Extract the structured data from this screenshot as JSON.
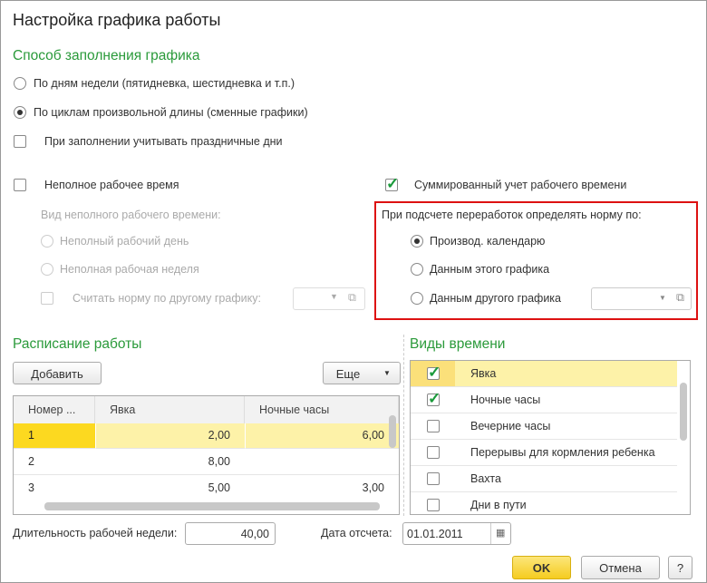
{
  "title": "Настройка графика работы",
  "fill_method": {
    "heading": "Способ заполнения графика",
    "options": [
      "По дням недели (пятидневка, шестидневка и т.п.)",
      "По циклам произвольной длины (сменные графики)"
    ],
    "selected": 1,
    "holidays_label": "При заполнении учитывать праздничные дни",
    "holidays_checked": false
  },
  "part_time": {
    "label": "Неполное рабочее время",
    "checked": false,
    "kind_label": "Вид неполного рабочего времени:",
    "options": [
      "Неполный рабочий день",
      "Неполная рабочая неделя"
    ],
    "norm_other_label": "Считать норму по другому графику:"
  },
  "summarized": {
    "label": "Суммированный учет рабочего времени",
    "checked": true,
    "norm_label": "При подсчете переработок определять норму по:",
    "options": [
      "Производ. календарю",
      "Данным этого графика",
      "Данным другого графика"
    ],
    "selected": 0
  },
  "schedule": {
    "heading": "Расписание работы",
    "add_label": "Добавить",
    "more_label": "Еще",
    "columns": [
      "Номер ...",
      "Явка",
      "Ночные часы"
    ],
    "rows": [
      [
        "1",
        "2,00",
        "6,00"
      ],
      [
        "2",
        "8,00",
        ""
      ],
      [
        "3",
        "5,00",
        "3,00"
      ]
    ]
  },
  "time_kinds": {
    "heading": "Виды времени",
    "items": [
      {
        "label": "Явка",
        "checked": true
      },
      {
        "label": "Ночные часы",
        "checked": true
      },
      {
        "label": "Вечерние часы",
        "checked": false
      },
      {
        "label": "Перерывы для кормления ребенка",
        "checked": false
      },
      {
        "label": "Вахта",
        "checked": false
      },
      {
        "label": "Дни в пути",
        "checked": false
      }
    ]
  },
  "week_length": {
    "label": "Длительность рабочей недели:",
    "value": "40,00"
  },
  "start_date": {
    "label": "Дата отсчета:",
    "value": "01.01.2011"
  },
  "buttons": {
    "ok": "OK",
    "cancel": "Отмена",
    "help": "?"
  },
  "colors": {
    "accent": "#2a9a3a",
    "selected_row": "#fdf2a8",
    "current_cell": "#fcd920",
    "highlight_box": "#dd1111",
    "ok_button": "#f9d63a"
  }
}
